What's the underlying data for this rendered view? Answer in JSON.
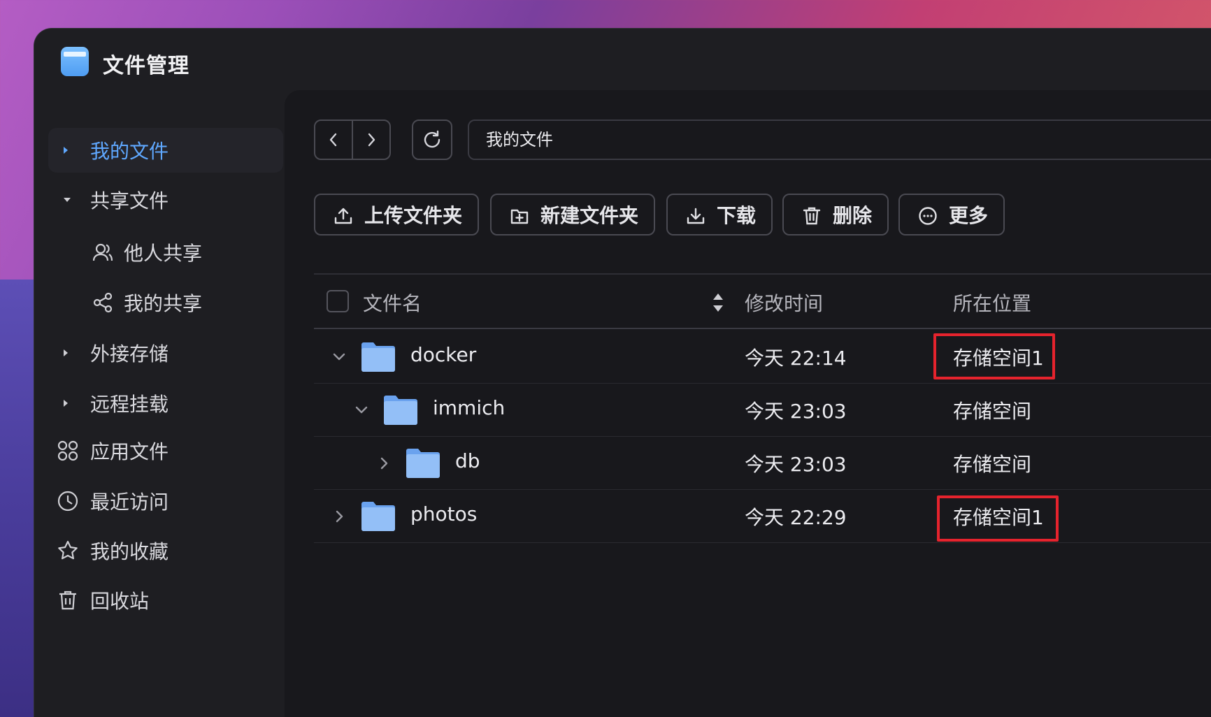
{
  "app": {
    "title": "文件管理"
  },
  "sidebar": {
    "items": [
      {
        "label": "我的文件",
        "icon": "caret-right-icon",
        "active": true
      },
      {
        "label": "共享文件",
        "icon": "caret-down-icon"
      },
      {
        "label": "他人共享",
        "icon": "users-icon",
        "sub": true
      },
      {
        "label": "我的共享",
        "icon": "share-icon",
        "sub": true
      },
      {
        "label": "外接存储",
        "icon": "caret-right-icon"
      },
      {
        "label": "远程挂载",
        "icon": "caret-right-icon"
      },
      {
        "label": "应用文件",
        "icon": "apps-icon"
      },
      {
        "label": "最近访问",
        "icon": "clock-icon"
      },
      {
        "label": "我的收藏",
        "icon": "star-icon"
      },
      {
        "label": "回收站",
        "icon": "trash-icon"
      }
    ]
  },
  "path": {
    "value": "我的文件"
  },
  "toolbar": {
    "upload_folder": "上传文件夹",
    "new_folder": "新建文件夹",
    "download": "下载",
    "delete": "删除",
    "more": "更多"
  },
  "table": {
    "headers": {
      "name": "文件名",
      "modified": "修改时间",
      "location": "所在位置"
    },
    "rows": [
      {
        "name": "docker",
        "modified": "今天 22:14",
        "location": "存储空间1",
        "expanded": true,
        "highlighted": true
      },
      {
        "name": "immich",
        "modified": "今天 23:03",
        "location": "存储空间",
        "expanded": true
      },
      {
        "name": "db",
        "modified": "今天 23:03",
        "location": "存储空间",
        "expanded": false
      },
      {
        "name": "photos",
        "modified": "今天 22:29",
        "location": "存储空间1",
        "expanded": false,
        "highlighted": true
      }
    ]
  },
  "colors": {
    "accent": "#5fa8ff",
    "highlight": "#e5232d",
    "folder": "#7fb2f5"
  }
}
